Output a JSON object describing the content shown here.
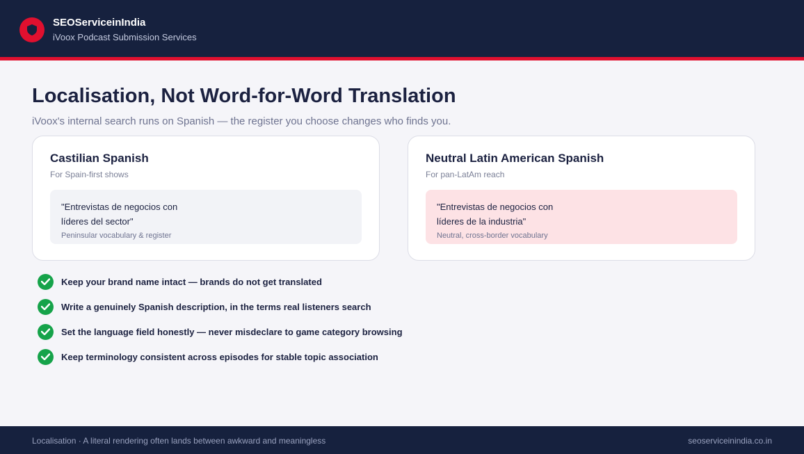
{
  "header": {
    "brand_name": "SEOServiceinIndia",
    "brand_subtitle": "iVoox Podcast Submission Services",
    "logo_icon": "shield-icon",
    "accent_color": "#e0102f",
    "background_color": "#16213e"
  },
  "main": {
    "title": "Localisation, Not Word-for-Word Translation",
    "subtitle": "iVoox's internal search runs on Spanish — the register you choose changes who finds you.",
    "cards": [
      {
        "title": "Castilian Spanish",
        "subtitle": "For Spain-first shows",
        "example": "\"Entrevistas de negocios con líderes del sector\"",
        "note": "Peninsular vocabulary & register"
      },
      {
        "title": "Neutral Latin American Spanish",
        "subtitle": "For pan-LatAm reach",
        "example": "\"Entrevistas de negocios con líderes de la industria\"",
        "note": "Neutral, cross-border vocabulary"
      }
    ],
    "checklist": [
      "Keep your brand name intact — brands do not get translated",
      "Write a genuinely Spanish description, in the terms real listeners search",
      "Set the language field honestly — never misdeclare to game category browsing",
      "Keep terminology consistent across episodes for stable topic association"
    ],
    "check_icon": "check-circle-icon",
    "check_color": "#16a34a"
  },
  "footer": {
    "left_text": "Localisation · A literal rendering often lands between awkward and meaningless",
    "right_text": "seoserviceinindia.co.in"
  }
}
